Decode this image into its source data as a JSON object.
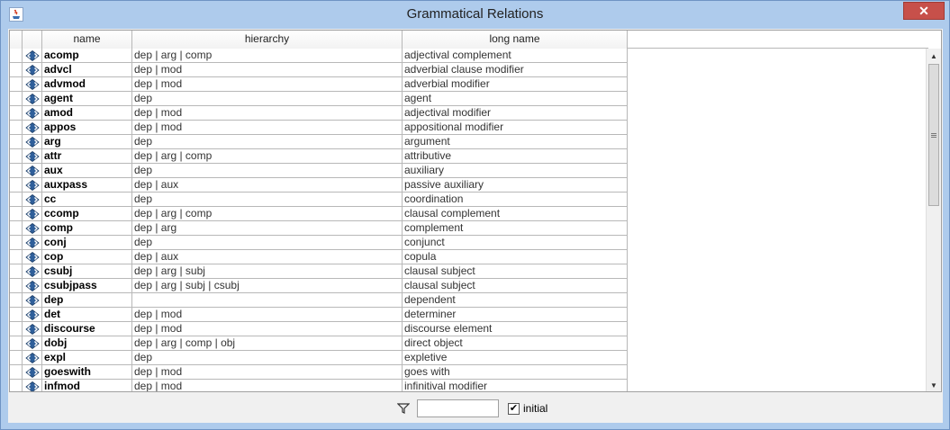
{
  "window": {
    "title": "Grammatical Relations",
    "close_glyph": "✕"
  },
  "table": {
    "columns": {
      "name": "name",
      "hierarchy": "hierarchy",
      "long_name": "long name"
    },
    "rows": [
      {
        "name": "acomp",
        "hierarchy": "dep | arg | comp",
        "long_name": "adjectival complement"
      },
      {
        "name": "advcl",
        "hierarchy": "dep | mod",
        "long_name": "adverbial clause modifier"
      },
      {
        "name": "advmod",
        "hierarchy": "dep | mod",
        "long_name": "adverbial modifier"
      },
      {
        "name": "agent",
        "hierarchy": "dep",
        "long_name": "agent"
      },
      {
        "name": "amod",
        "hierarchy": "dep | mod",
        "long_name": "adjectival modifier"
      },
      {
        "name": "appos",
        "hierarchy": "dep | mod",
        "long_name": "appositional modifier"
      },
      {
        "name": "arg",
        "hierarchy": "dep",
        "long_name": "argument"
      },
      {
        "name": "attr",
        "hierarchy": "dep | arg | comp",
        "long_name": "attributive"
      },
      {
        "name": "aux",
        "hierarchy": "dep",
        "long_name": "auxiliary"
      },
      {
        "name": "auxpass",
        "hierarchy": "dep | aux",
        "long_name": "passive auxiliary"
      },
      {
        "name": "cc",
        "hierarchy": "dep",
        "long_name": "coordination"
      },
      {
        "name": "ccomp",
        "hierarchy": "dep | arg | comp",
        "long_name": "clausal complement"
      },
      {
        "name": "comp",
        "hierarchy": "dep | arg",
        "long_name": "complement"
      },
      {
        "name": "conj",
        "hierarchy": "dep",
        "long_name": "conjunct"
      },
      {
        "name": "cop",
        "hierarchy": "dep | aux",
        "long_name": "copula"
      },
      {
        "name": "csubj",
        "hierarchy": "dep | arg | subj",
        "long_name": "clausal subject"
      },
      {
        "name": "csubjpass",
        "hierarchy": "dep | arg | subj | csubj",
        "long_name": "clausal subject"
      },
      {
        "name": "dep",
        "hierarchy": "",
        "long_name": "dependent"
      },
      {
        "name": "det",
        "hierarchy": "dep | mod",
        "long_name": "determiner"
      },
      {
        "name": "discourse",
        "hierarchy": "dep | mod",
        "long_name": "discourse element"
      },
      {
        "name": "dobj",
        "hierarchy": "dep | arg | comp | obj",
        "long_name": "direct object"
      },
      {
        "name": "expl",
        "hierarchy": "dep",
        "long_name": "expletive"
      },
      {
        "name": "goeswith",
        "hierarchy": "dep | mod",
        "long_name": "goes with"
      },
      {
        "name": "infmod",
        "hierarchy": "dep | mod",
        "long_name": "infinitival modifier"
      }
    ],
    "row_icon": "diamond-arrows-icon"
  },
  "footer": {
    "filter_icon": "funnel-filter-icon",
    "filter_value": "",
    "initial_checked": true,
    "initial_label": "initial"
  }
}
